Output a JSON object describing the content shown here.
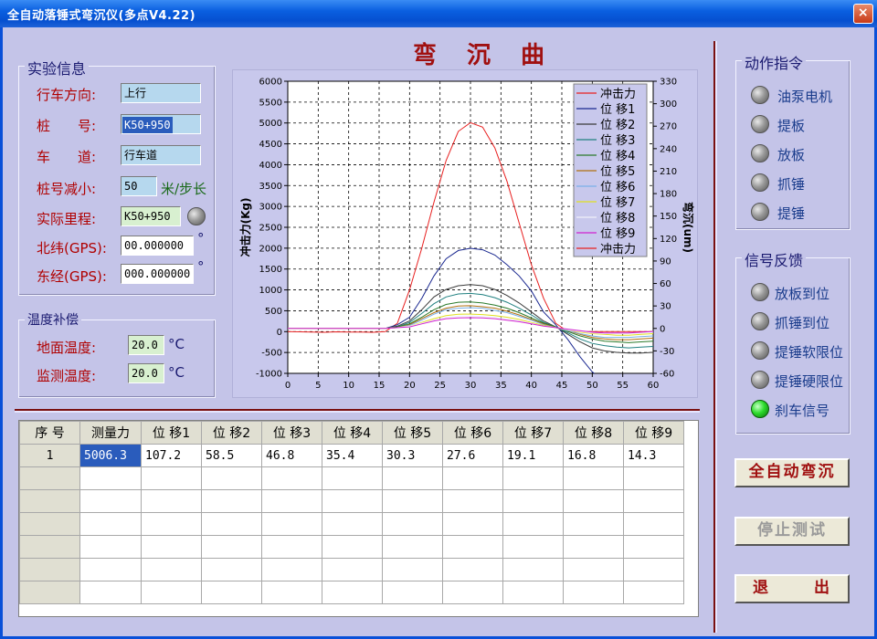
{
  "window": {
    "title": "全自动落锤式弯沉仪(多点V4.22)",
    "close_glyph": "×"
  },
  "chart_title": "弯 沉 曲 线",
  "experiment": {
    "legend": "实验信息",
    "fields": [
      {
        "label": "行车方向:",
        "value": "上行"
      },
      {
        "label": "桩　　号:",
        "value": "K50+950"
      },
      {
        "label": "车　　道:",
        "value": "行车道"
      },
      {
        "label": "桩号减小:",
        "value": "50",
        "unit": "米/步长"
      },
      {
        "label": "实际里程:",
        "value": "K50+950"
      },
      {
        "label": "北纬(GPS):",
        "value": "00.000000",
        "unit": "°"
      },
      {
        "label": "东经(GPS):",
        "value": "000.000000",
        "unit": "°"
      }
    ]
  },
  "temperature": {
    "legend": "温度补偿",
    "fields": [
      {
        "label": "地面温度:",
        "value": "20.0",
        "unit": "°C"
      },
      {
        "label": "监测温度:",
        "value": "20.0",
        "unit": "°C"
      }
    ]
  },
  "action": {
    "legend": "动作指令",
    "items": [
      {
        "label": "油泵电机",
        "on": false
      },
      {
        "label": "提板",
        "on": false
      },
      {
        "label": "放板",
        "on": false
      },
      {
        "label": "抓锤",
        "on": false
      },
      {
        "label": "提锤",
        "on": false
      }
    ]
  },
  "signal": {
    "legend": "信号反馈",
    "items": [
      {
        "label": "放板到位",
        "on": false
      },
      {
        "label": "抓锤到位",
        "on": false
      },
      {
        "label": "提锤软限位",
        "on": false
      },
      {
        "label": "提锤硬限位",
        "on": false
      },
      {
        "label": "刹车信号",
        "on": true
      }
    ]
  },
  "buttons": {
    "auto": "全自动弯沉",
    "stop": "停止测试",
    "exit_left": "退",
    "exit_right": "出"
  },
  "table": {
    "headers": [
      "序 号",
      "测量力",
      "位 移1",
      "位 移2",
      "位 移3",
      "位 移4",
      "位 移5",
      "位 移6",
      "位 移7",
      "位 移8",
      "位 移9"
    ],
    "rows": [
      [
        "1",
        "5006.3",
        "107.2",
        "58.5",
        "46.8",
        "35.4",
        "30.3",
        "27.6",
        "19.1",
        "16.8",
        "14.3"
      ]
    ],
    "empty_rows": 6
  },
  "chart_data": {
    "type": "line",
    "x": [
      0,
      2,
      4,
      6,
      8,
      10,
      12,
      14,
      16,
      18,
      20,
      22,
      24,
      26,
      28,
      30,
      32,
      34,
      36,
      38,
      40,
      42,
      44,
      46,
      48,
      50,
      52,
      54,
      56,
      58,
      60
    ],
    "xlim": [
      0,
      60
    ],
    "xticks": [
      0,
      5,
      10,
      15,
      20,
      25,
      30,
      35,
      40,
      45,
      50,
      55,
      60
    ],
    "ylim_left": [
      -1000,
      6000
    ],
    "yticks_left": [
      -1000,
      -500,
      0,
      500,
      1000,
      1500,
      2000,
      2500,
      3000,
      3500,
      4000,
      4500,
      5000,
      5500,
      6000
    ],
    "ylim_right": [
      -60,
      330
    ],
    "yticks_right": [
      -60,
      -30,
      0,
      30,
      60,
      90,
      120,
      150,
      180,
      210,
      240,
      270,
      300,
      330
    ],
    "ylabel_left": "冲击力(Kg)",
    "ylabel_right": "弯沉(um)",
    "grid": true,
    "legend_position": "top-right",
    "series": [
      {
        "name": "冲击力",
        "axis": "left",
        "color": "#e82020",
        "values": [
          0,
          -5,
          -10,
          -15,
          -5,
          -10,
          -10,
          -15,
          0,
          200,
          1000,
          2000,
          3100,
          4100,
          4800,
          5006,
          4900,
          4400,
          3600,
          2600,
          1600,
          800,
          200,
          0,
          0,
          0,
          0,
          0,
          0,
          0,
          0
        ]
      },
      {
        "name": "位 移1",
        "axis": "right",
        "color": "#1a2890",
        "values": [
          0,
          0,
          0,
          0,
          0,
          0,
          0,
          0,
          0,
          5,
          15,
          40,
          70,
          93,
          104,
          107,
          105,
          98,
          85,
          70,
          50,
          22,
          5,
          -15,
          -38,
          -58,
          -70,
          -75,
          -78,
          -80,
          -80
        ]
      },
      {
        "name": "位 移2",
        "axis": "right",
        "color": "#3a3a3a",
        "values": [
          0,
          0,
          0,
          0,
          0,
          0,
          0,
          0,
          0,
          3,
          10,
          25,
          42,
          52,
          57,
          58.5,
          57,
          52,
          44,
          34,
          22,
          10,
          2,
          -8,
          -18,
          -26,
          -30,
          -32,
          -33,
          -33,
          -32
        ]
      },
      {
        "name": "位 移3",
        "axis": "right",
        "color": "#208080",
        "values": [
          0,
          0,
          0,
          0,
          0,
          0,
          0,
          0,
          0,
          2,
          8,
          20,
          33,
          42,
          46,
          46.8,
          45,
          41,
          35,
          27,
          18,
          8,
          2,
          -6,
          -14,
          -20,
          -23,
          -25,
          -26,
          -25,
          -24
        ]
      },
      {
        "name": "位 移4",
        "axis": "right",
        "color": "#2a7a2a",
        "values": [
          0,
          0,
          0,
          0,
          0,
          0,
          0,
          0,
          0,
          2,
          6,
          15,
          25,
          32,
          35,
          35.4,
          34,
          31,
          27,
          21,
          14,
          7,
          2,
          -4,
          -10,
          -14,
          -17,
          -18,
          -19,
          -18,
          -17
        ]
      },
      {
        "name": "位 移5",
        "axis": "right",
        "color": "#b07010",
        "values": [
          0,
          0,
          0,
          0,
          0,
          0,
          0,
          0,
          0,
          1,
          5,
          13,
          21,
          27,
          30,
          30.3,
          29,
          27,
          23,
          18,
          12,
          6,
          1,
          -3,
          -8,
          -12,
          -14,
          -15,
          -15,
          -14,
          -13
        ]
      },
      {
        "name": "位 移6",
        "axis": "right",
        "color": "#7ab0e8",
        "values": [
          0,
          0,
          0,
          0,
          0,
          0,
          0,
          0,
          0,
          1,
          4,
          11,
          19,
          25,
          27,
          27.6,
          27,
          24,
          21,
          16,
          11,
          5,
          1,
          -3,
          -7,
          -10,
          -12,
          -12,
          -12,
          -11,
          -10
        ]
      },
      {
        "name": "位 移7",
        "axis": "right",
        "color": "#e0e020",
        "values": [
          0,
          0,
          0,
          0,
          0,
          0,
          0,
          0,
          0,
          1,
          3,
          8,
          13,
          17,
          19,
          19.1,
          18.5,
          17,
          15,
          12,
          8,
          4,
          1,
          -2,
          -5,
          -7,
          -8,
          -9,
          -9,
          -8,
          -7
        ]
      },
      {
        "name": "位 移8",
        "axis": "right",
        "color": "#f0f0f8",
        "values": [
          0,
          0,
          0,
          0,
          0,
          0,
          0,
          0,
          0,
          1,
          3,
          7,
          11,
          15,
          16.5,
          16.8,
          16,
          15,
          13,
          10,
          7,
          3,
          1,
          -2,
          -4,
          -6,
          -7,
          -7,
          -7,
          -6,
          -5
        ]
      },
      {
        "name": "位 移9",
        "axis": "right",
        "color": "#d020d0",
        "values": [
          0,
          0,
          0,
          0,
          0,
          0,
          0,
          0,
          0,
          1,
          2,
          6,
          10,
          13,
          14,
          14.3,
          14,
          13,
          11,
          9,
          6,
          3,
          1,
          -1,
          -3,
          -5,
          -6,
          -6,
          -6,
          -5,
          -4
        ]
      },
      {
        "name": "冲击力",
        "axis": "left",
        "color": "#e82020",
        "values": []
      }
    ]
  }
}
